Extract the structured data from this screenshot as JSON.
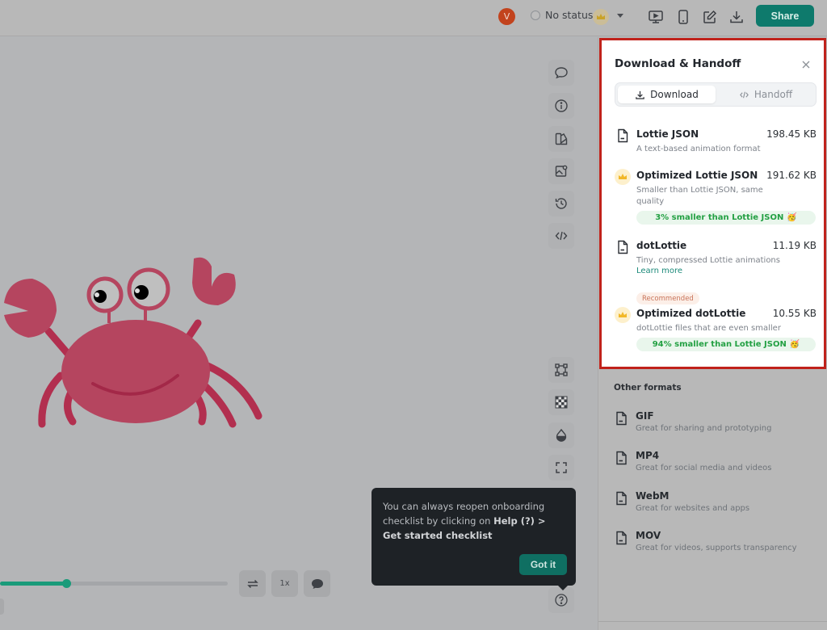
{
  "topbar": {
    "avatar_initial": "V",
    "status_label": "No status",
    "share_label": "Share",
    "icons": [
      "present-icon",
      "mobile-preview-icon",
      "edit-icon",
      "download-icon"
    ]
  },
  "canvas": {
    "toolbar_top": [
      "comment-icon",
      "info-icon",
      "theme-icon",
      "image-icon",
      "history-icon",
      "code-icon"
    ],
    "toolbar_bottom": [
      "bounding-box-icon",
      "transparency-grid-icon",
      "background-color-icon",
      "fullscreen-icon"
    ],
    "artwork": "crab-illustration"
  },
  "tooltip": {
    "text_prefix": "You can always reopen onboarding checklist by clicking on ",
    "text_bold": "Help (?) > Get started checklist",
    "button_label": "Got it"
  },
  "playback": {
    "progress": 0.29,
    "loop_icon": "loop-icon",
    "speed_label": "1x",
    "comment_icon": "comment-filled-icon"
  },
  "panel": {
    "title": "Download & Handoff",
    "tabs": [
      {
        "label": "Download",
        "active": true
      },
      {
        "label": "Handoff",
        "active": false
      }
    ],
    "formats": [
      {
        "name": "Lottie JSON",
        "size": "198.45 KB",
        "description": "A text-based animation format",
        "premium": false
      },
      {
        "name": "Optimized Lottie JSON",
        "size": "191.62 KB",
        "description": "Smaller than Lottie JSON, same quality",
        "premium": true,
        "saving": "3% smaller than Lottie JSON"
      },
      {
        "name": "dotLottie",
        "size": "11.19 KB",
        "description": "Tiny, compressed Lottie animations",
        "link": "Learn more",
        "premium": false
      },
      {
        "name": "Optimized dotLottie",
        "size": "10.55 KB",
        "description": "dotLottie files that are even smaller",
        "premium": true,
        "badge": "Recommended",
        "saving": "94% smaller than Lottie JSON"
      }
    ],
    "other_formats_title": "Other formats",
    "other_formats": [
      {
        "name": "GIF",
        "description": "Great for sharing and prototyping"
      },
      {
        "name": "MP4",
        "description": "Great for social media and videos"
      },
      {
        "name": "WebM",
        "description": "Great for websites and apps"
      },
      {
        "name": "MOV",
        "description": "Great for videos, supports transparency"
      }
    ]
  },
  "colors": {
    "accent": "#0e7a6c",
    "highlight_border": "#c0221b",
    "saving_text": "#23a043",
    "progress": "#1a9b7a"
  }
}
